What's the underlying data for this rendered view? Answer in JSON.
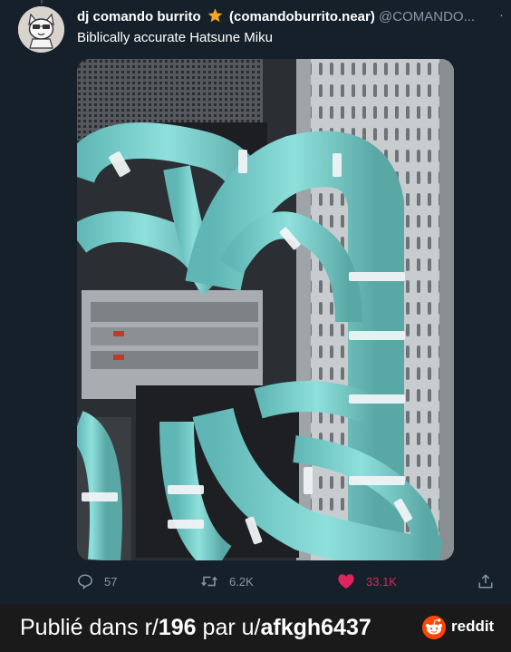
{
  "tweet": {
    "display_name": "dj comando burrito",
    "handle_paren": "(comandoburrito.near)",
    "handle": "@COMANDO...",
    "more": "·",
    "text": "Biblically accurate Hatsune Miku",
    "actions": {
      "replies": "57",
      "retweets": "6.2K",
      "likes": "33.1K"
    }
  },
  "footer": {
    "prefix": "Publié dans r/",
    "subreddit": "196",
    "middle": " par u/",
    "user": "afkgh6437",
    "brand": "reddit"
  },
  "colors": {
    "background": "#15202b",
    "secondary_text": "#8899a6",
    "like": "#e0245e",
    "cable": "#7fd4d0",
    "reddit_orange": "#ff4500"
  }
}
